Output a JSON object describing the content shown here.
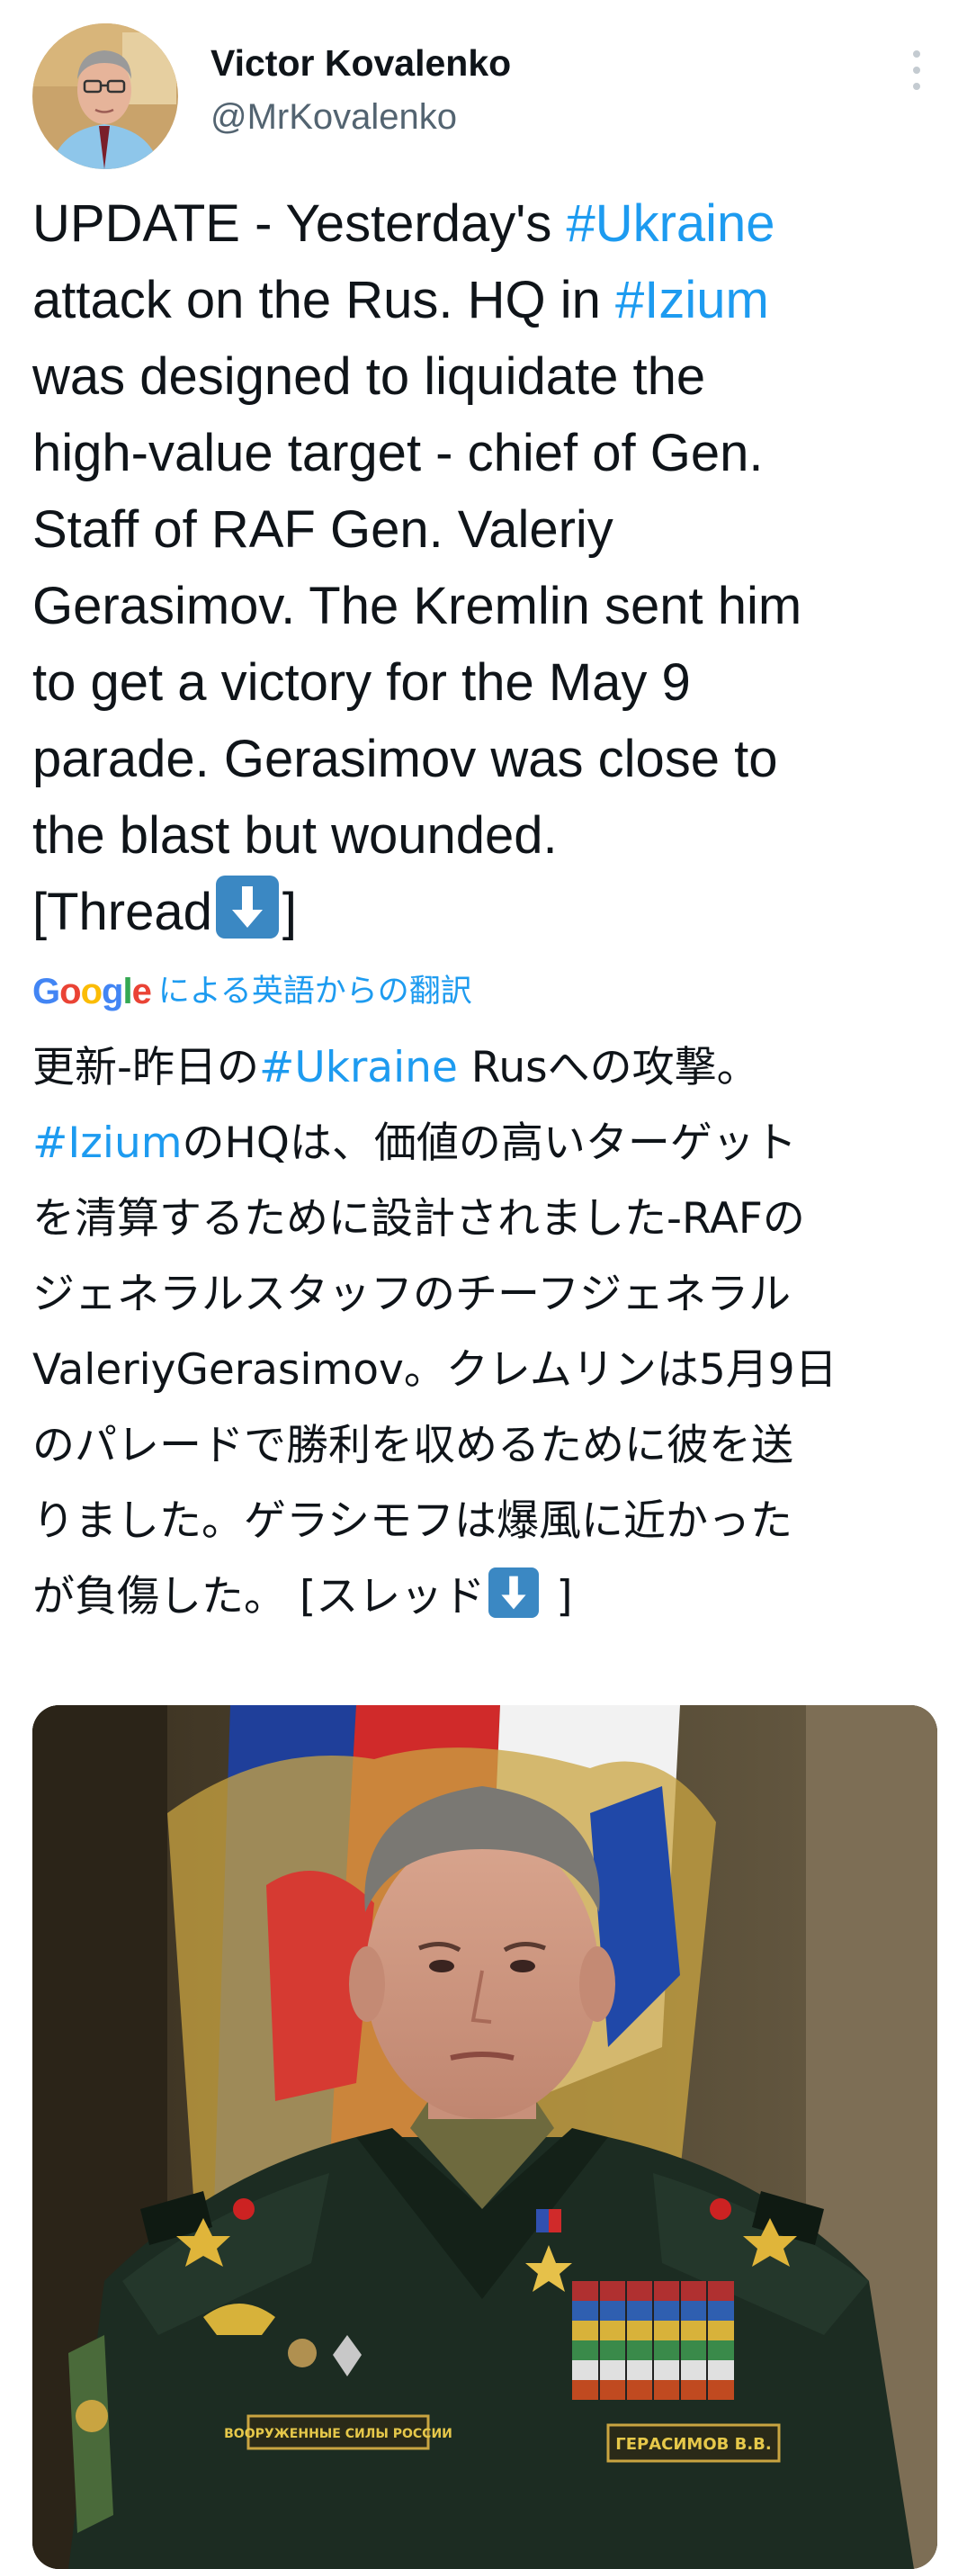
{
  "author": {
    "display_name": "Victor Kovalenko",
    "handle": "@MrKovalenko",
    "avatar_icon": "avatar-photo"
  },
  "more_icon": "more-vertical-icon",
  "tweet": {
    "lines": [
      [
        {
          "t": "UPDATE - Yesterday's "
        },
        {
          "t": "#Ukraine",
          "tag": true
        }
      ],
      [
        {
          "t": "attack on the Rus. HQ in "
        },
        {
          "t": "#Izium",
          "tag": true
        }
      ],
      [
        {
          "t": "was designed to liquidate the"
        }
      ],
      [
        {
          "t": "high-value target - chief of Gen."
        }
      ],
      [
        {
          "t": "Staff of RAF Gen. Valeriy"
        }
      ],
      [
        {
          "t": "Gerasimov. The Kremlin sent him"
        }
      ],
      [
        {
          "t": "to get a victory for the May 9"
        }
      ],
      [
        {
          "t": "parade. Gerasimov was close to"
        }
      ],
      [
        {
          "t": "the blast but wounded."
        }
      ],
      [
        {
          "t": "[Thread"
        },
        {
          "emoji": "down-arrow-emoji"
        },
        {
          "t": "]"
        }
      ]
    ]
  },
  "translation": {
    "provider_logo": "Google",
    "label": "による英語からの翻訳",
    "lines": [
      [
        {
          "t": "更新-昨日の"
        },
        {
          "t": "#Ukraine",
          "tag": true
        },
        {
          "t": " Rusへの攻撃。"
        }
      ],
      [
        {
          "t": "#Izium",
          "tag": true
        },
        {
          "t": "のHQは、価値の高いターゲット"
        }
      ],
      [
        {
          "t": "を清算するために設計されました-RAFの"
        }
      ],
      [
        {
          "t": "ジェネラルスタッフのチーフジェネラル"
        }
      ],
      [
        {
          "t": "ValeriyGerasimov。クレムリンは5月9日"
        }
      ],
      [
        {
          "t": "のパレードで勝利を収めるために彼を送"
        }
      ],
      [
        {
          "t": "りました。ゲラシモフは爆風に近かった"
        }
      ],
      [
        {
          "t": "が負傷した。 [スレッド"
        },
        {
          "emoji": "down-arrow-emoji"
        },
        {
          "t": " ]"
        }
      ]
    ]
  },
  "media": {
    "kind": "photo",
    "nameplate": "ГЕРАСИМОВ В.В.",
    "chest_tab": "ВООРУЖЕННЫЕ СИЛЫ РОССИИ"
  },
  "colors": {
    "link": "#1d9bf0",
    "text": "#0f1419",
    "secondary": "#536471",
    "emoji_bg": "#3b88c3"
  }
}
